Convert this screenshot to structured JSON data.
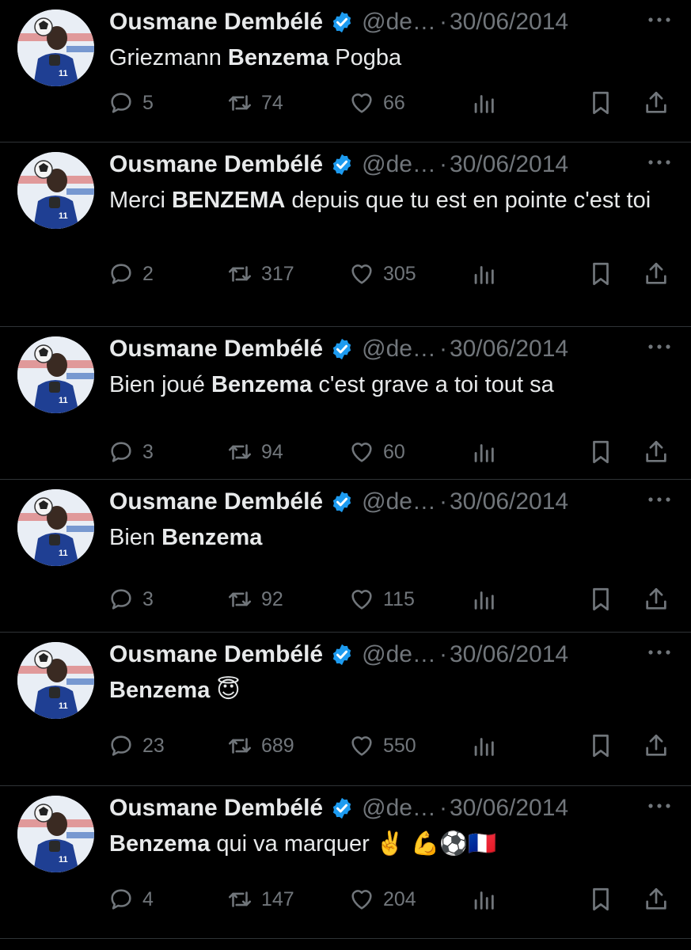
{
  "colors": {
    "background": "#000000",
    "text": "#e7e9ea",
    "muted": "#71767b",
    "verified": "#1d9bf0",
    "divider": "#2f3336"
  },
  "icons": {
    "reply": "chat-bubble-icon",
    "retweet": "retweet-icon",
    "like": "heart-icon",
    "views": "analytics-bars-icon",
    "bookmark": "bookmark-icon",
    "share": "share-icon",
    "more": "more-dots-icon",
    "verified": "verified-badge-icon"
  },
  "tweets": [
    {
      "author": {
        "name": "Ousmane Dembélé",
        "handle": "@de…"
      },
      "separator": "·",
      "date": "30/06/2014",
      "text": [
        {
          "t": "Griezmann ",
          "b": false
        },
        {
          "t": "Benzema",
          "b": true
        },
        {
          "t": " Pogba",
          "b": false
        }
      ],
      "stats": {
        "replies": "5",
        "retweets": "74",
        "likes": "66"
      }
    },
    {
      "author": {
        "name": "Ousmane Dembélé",
        "handle": "@de…"
      },
      "separator": "·",
      "date": "30/06/2014",
      "text": [
        {
          "t": "Merci ",
          "b": false
        },
        {
          "t": "BENZEMA",
          "b": true
        },
        {
          "t": " depuis que tu est en pointe c'est toi",
          "b": false
        }
      ],
      "stats": {
        "replies": "2",
        "retweets": "317",
        "likes": "305"
      }
    },
    {
      "author": {
        "name": "Ousmane Dembélé",
        "handle": "@de…"
      },
      "separator": "·",
      "date": "30/06/2014",
      "text": [
        {
          "t": "Bien joué ",
          "b": false
        },
        {
          "t": "Benzema",
          "b": true
        },
        {
          "t": " c'est grave a toi tout sa",
          "b": false
        }
      ],
      "stats": {
        "replies": "3",
        "retweets": "94",
        "likes": "60"
      }
    },
    {
      "author": {
        "name": "Ousmane Dembélé",
        "handle": "@de…"
      },
      "separator": "·",
      "date": "30/06/2014",
      "text": [
        {
          "t": "Bien ",
          "b": false
        },
        {
          "t": "Benzema",
          "b": true
        }
      ],
      "stats": {
        "replies": "3",
        "retweets": "92",
        "likes": "115"
      }
    },
    {
      "author": {
        "name": "Ousmane Dembélé",
        "handle": "@de…"
      },
      "separator": "·",
      "date": "30/06/2014",
      "text": [
        {
          "t": "Benzema",
          "b": true
        },
        {
          "t": " 😇",
          "b": false
        }
      ],
      "stats": {
        "replies": "23",
        "retweets": "689",
        "likes": "550"
      }
    },
    {
      "author": {
        "name": "Ousmane Dembélé",
        "handle": "@de…"
      },
      "separator": "·",
      "date": "30/06/2014",
      "text": [
        {
          "t": "Benzema",
          "b": true
        },
        {
          "t": " qui va marquer ✌️ 💪⚽🇫🇷",
          "b": false
        }
      ],
      "stats": {
        "replies": "4",
        "retweets": "147",
        "likes": "204"
      }
    }
  ]
}
